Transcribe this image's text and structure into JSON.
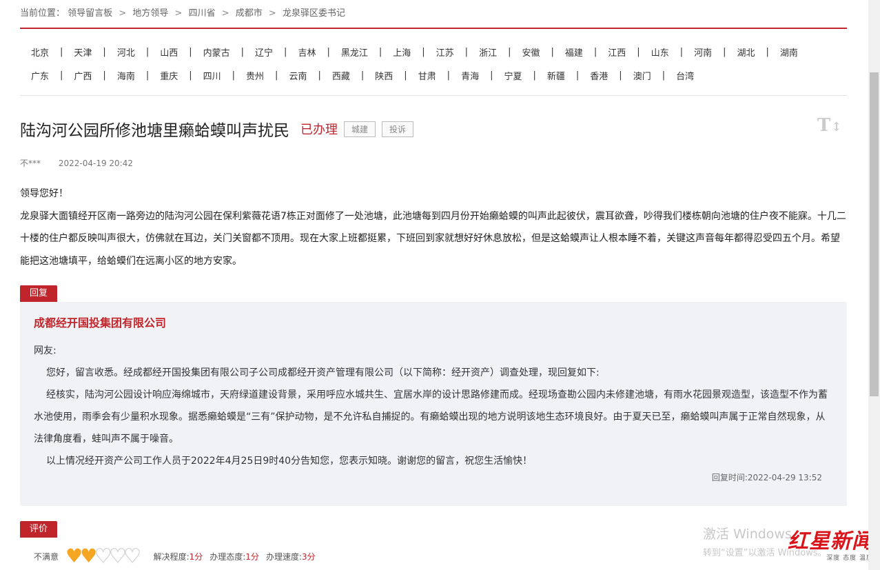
{
  "breadcrumb": {
    "prefix": "当前位置：",
    "items": [
      "领导留言板",
      "地方领导",
      "四川省",
      "成都市",
      "龙泉驿区委书记"
    ],
    "separator": ">"
  },
  "regions": {
    "row1": [
      "北京",
      "天津",
      "河北",
      "山西",
      "内蒙古",
      "辽宁",
      "吉林",
      "黑龙江",
      "上海",
      "江苏",
      "浙江",
      "安徽",
      "福建",
      "江西",
      "山东",
      "河南",
      "湖北",
      "湖南"
    ],
    "row2": [
      "广东",
      "广西",
      "海南",
      "重庆",
      "四川",
      "贵州",
      "云南",
      "西藏",
      "陕西",
      "甘肃",
      "青海",
      "宁夏",
      "新疆",
      "香港",
      "澳门",
      "台湾"
    ],
    "divider": "|"
  },
  "post": {
    "title": "陆沟河公园所修池塘里癞蛤蟆叫声扰民",
    "status": "已办理",
    "tags": [
      "城建",
      "投诉"
    ],
    "author": "不***",
    "time": "2022-04-19 20:42",
    "greeting": "领导您好！",
    "body": "龙泉驿大面镇经开区南一路旁边的陆沟河公园在保利紫薇花语7栋正对面修了一处池塘，此池塘每到四月份开始癞蛤蟆的叫声此起彼伏，震耳欲聋，吵得我们楼栋朝向池塘的住户夜不能寐。十几二十楼的住户都反映叫声很大，仿佛就在耳边，关门关窗都不顶用。现在大家上班都挺累，下班回到家就想好好休息放松，但是这蛤蟆声让人根本睡不着，关键这声音每年都得忍受四五个月。希望能把这池塘填平，给蛤蟆们在远离小区的地方安家。"
  },
  "font_toggle": {
    "glyph": "T",
    "arrow": "↕"
  },
  "reply": {
    "tab_label": "回复",
    "org": "成都经开国投集团有限公司",
    "salutation": "网友:",
    "paragraphs": [
      "您好，留言收悉。经成都经开国投集团有限公司子公司成都经开资产管理有限公司（以下简称：经开资产）调查处理，现回复如下:",
      "经核实，陆沟河公园设计响应海绵城市，天府绿道建设背景，采用呼应水城共生、宜居水岸的设计思路修建而成。经现场查勘公园内未修建池塘，有雨水花园景观造型，该造型不作为蓄水池使用，雨季会有少量积水现象。据悉癞蛤蟆是“三有”保护动物，是不允许私自捕捉的。有癞蛤蟆出现的地方说明该地生态环境良好。由于夏天已至，癞蛤蟆叫声属于正常自然现象，从法律角度看，蛙叫声不属于噪音。",
      "以上情况经开资产公司工作人员于2022年4月25日9时40分告知您，您表示知晓。谢谢您的留言，祝您生活愉快！"
    ],
    "time_label": "回复时间:",
    "time": "2022-04-29 13:52"
  },
  "evaluation": {
    "tab_label": "评价",
    "rating_text": "不满意",
    "hearts_filled": 2,
    "hearts_total": 5,
    "metrics": [
      {
        "label": "解决程度:",
        "value": "1分"
      },
      {
        "label": "办理态度:",
        "value": "1分"
      },
      {
        "label": "办理速度:",
        "value": "3分"
      }
    ]
  },
  "watermark": {
    "line1": "激活 Windows",
    "line2": "转到“设置”以激活 Windows。"
  },
  "logo": {
    "main": "红星新闻",
    "sub": "深度 态度 温度"
  },
  "colors": {
    "accent": "#c0252b",
    "heart_fill": "#f5a623"
  }
}
